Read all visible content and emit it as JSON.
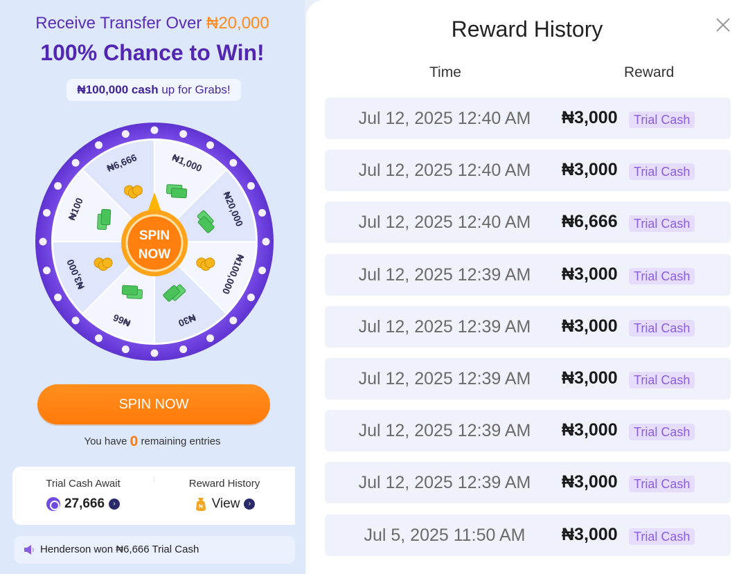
{
  "promo": {
    "line1_prefix": "Receive Transfer Over ",
    "line1_amount": "₦20,000",
    "line2": "100% Chance to Win!",
    "grabs_bold": "₦100,000 cash",
    "grabs_rest": " up for Grabs!"
  },
  "wheel": {
    "segments": [
      "₦6,666",
      "₦1,000",
      "₦20,000",
      "₦100,000",
      "₦30",
      "₦66",
      "₦3,000",
      "₦100"
    ],
    "center_line1": "SPIN",
    "center_line2": "NOW"
  },
  "spin_button": "SPIN NOW",
  "entries": {
    "prefix": "You have ",
    "count": "0",
    "suffix": " remaining entries"
  },
  "summary": {
    "trial_label": "Trial Cash Await",
    "trial_value": "27,666",
    "history_label": "Reward History",
    "history_link": "View"
  },
  "ticker": "Henderson won ₦6,666 Trial Cash",
  "history": {
    "title": "Reward History",
    "col_time": "Time",
    "col_reward": "Reward",
    "rows": [
      {
        "time": "Jul 12, 2025 12:40 AM",
        "amount": "₦3,000",
        "tag": "Trial Cash"
      },
      {
        "time": "Jul 12, 2025 12:40 AM",
        "amount": "₦3,000",
        "tag": "Trial Cash"
      },
      {
        "time": "Jul 12, 2025 12:40 AM",
        "amount": "₦6,666",
        "tag": "Trial Cash"
      },
      {
        "time": "Jul 12, 2025 12:39 AM",
        "amount": "₦3,000",
        "tag": "Trial Cash"
      },
      {
        "time": "Jul 12, 2025 12:39 AM",
        "amount": "₦3,000",
        "tag": "Trial Cash"
      },
      {
        "time": "Jul 12, 2025 12:39 AM",
        "amount": "₦3,000",
        "tag": "Trial Cash"
      },
      {
        "time": "Jul 12, 2025 12:39 AM",
        "amount": "₦3,000",
        "tag": "Trial Cash"
      },
      {
        "time": "Jul 12, 2025 12:39 AM",
        "amount": "₦3,000",
        "tag": "Trial Cash"
      },
      {
        "time": "Jul 5, 2025 11:50 AM",
        "amount": "₦3,000",
        "tag": "Trial Cash"
      }
    ]
  },
  "colors": {
    "purple": "#5226b0",
    "orange": "#ff7a0a",
    "tag_bg": "#e6dcfb",
    "tag_text": "#8a5ce0"
  },
  "icons": {
    "close": "close-icon",
    "coin": "coin-icon",
    "bag": "money-bag-icon",
    "speaker": "speaker-icon",
    "arrow": "chevron-right-icon"
  }
}
